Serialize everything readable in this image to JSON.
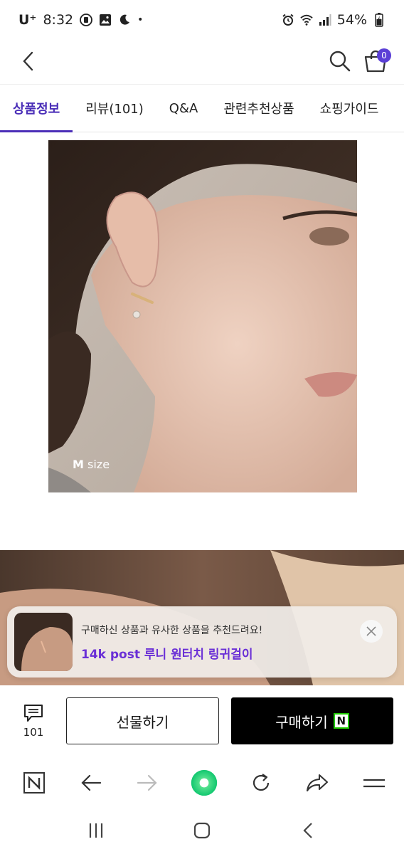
{
  "status": {
    "carrier": "U⁺",
    "time": "8:32",
    "battery": "54%"
  },
  "header": {
    "cart_count": "0"
  },
  "tabs": [
    {
      "label": "상품정보",
      "active": true
    },
    {
      "label": "리뷰(101)",
      "active": false
    },
    {
      "label": "Q&A",
      "active": false
    },
    {
      "label": "관련추천상품",
      "active": false
    },
    {
      "label": "쇼핑가이드",
      "active": false
    }
  ],
  "product_image": {
    "size_label_bold": "M",
    "size_label_rest": " size"
  },
  "recommendation": {
    "subtitle": "구매하신 상품과 유사한 상품을 추천드려요!",
    "title": "14k post 루니 원터치 링귀걸이"
  },
  "buy_bar": {
    "review_count": "101",
    "gift_label": "선물하기",
    "buy_label": "구매하기",
    "npay_letter": "N"
  },
  "browser": {
    "home_letter": "N"
  },
  "colors": {
    "accent": "#4b2fb8",
    "badge": "#5b3fd6",
    "recommend_title": "#6a2fd6",
    "buy_button": "#000000",
    "naver_green": "#1ec800"
  }
}
